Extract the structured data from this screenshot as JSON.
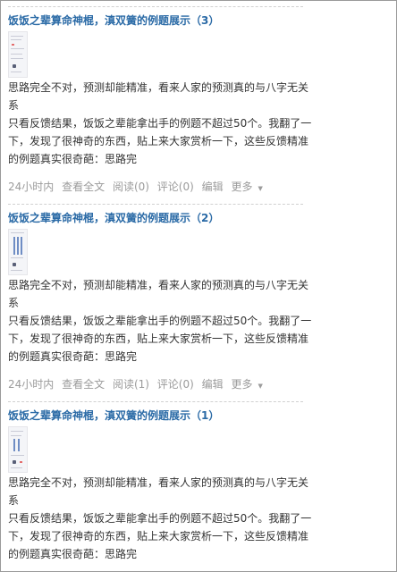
{
  "posts": [
    {
      "title": "饭饭之辈算命神棍，滇双簧的例题展示（3）",
      "para1": "思路完全不对，预测却能精准，看来人家的预测真的与八字无关系",
      "para2": "只看反馈结果，饭饭之辈能拿出手的例题不超过50个。我翻了一下，发现了很神奇的东西，贴上来大家赏析一下，这些反馈精准的例题真实很奇葩：思路完",
      "meta": {
        "time": "24小时内",
        "read_full": "查看全文",
        "reads": "阅读(0)",
        "comments": "评论(0)",
        "edit": "编辑",
        "more": "更多"
      }
    },
    {
      "title": "饭饭之辈算命神棍，滇双簧的例题展示（2）",
      "para1": "思路完全不对，预测却能精准，看来人家的预测真的与八字无关系",
      "para2": "只看反馈结果，饭饭之辈能拿出手的例题不超过50个。我翻了一下，发现了很神奇的东西，贴上来大家赏析一下，这些反馈精准的例题真实很奇葩：思路完",
      "meta": {
        "time": "24小时内",
        "read_full": "查看全文",
        "reads": "阅读(1)",
        "comments": "评论(0)",
        "edit": "编辑",
        "more": "更多"
      }
    },
    {
      "title": "饭饭之辈算命神棍，滇双簧的例题展示（1）",
      "para1": "思路完全不对，预测却能精准，看来人家的预测真的与八字无关系",
      "para2": "只看反馈结果，饭饭之辈能拿出手的例题不超过50个。我翻了一下，发现了很神奇的东西，贴上来大家赏析一下，这些反馈精准的例题真实很奇葩：思路完"
    }
  ]
}
